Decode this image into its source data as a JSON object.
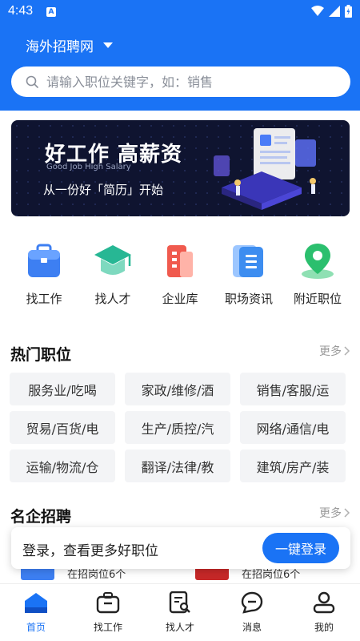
{
  "status_bar": {
    "time": "4:43",
    "notification_badge": "A"
  },
  "header": {
    "site_name": "海外招聘网",
    "search_placeholder": "请输入职位关键字，如：销售"
  },
  "banner": {
    "headline": "好工作 高薪资",
    "subline": "Good Job  High Salary",
    "tagline": "从一份好「简历」开始"
  },
  "quick_links": [
    {
      "label": "找工作",
      "icon": "briefcase-icon",
      "color": "#3d7ff2"
    },
    {
      "label": "找人才",
      "icon": "graduation-cap-icon",
      "color": "#27b794"
    },
    {
      "label": "企业库",
      "icon": "building-icon",
      "color": "#f05a4e"
    },
    {
      "label": "职场资讯",
      "icon": "news-icon",
      "color": "#3d8df0"
    },
    {
      "label": "附近职位",
      "icon": "location-pin-icon",
      "color": "#2bbf6e"
    }
  ],
  "hot_jobs": {
    "title": "热门职位",
    "more_label": "更多",
    "tags": [
      "服务业/吃喝",
      "家政/维修/酒",
      "销售/客服/运",
      "贸易/百货/电",
      "生产/质控/汽",
      "网络/通信/电",
      "运输/物流/仓",
      "翻译/法律/教",
      "建筑/房产/装"
    ]
  },
  "companies": {
    "title": "名企招聘",
    "more_label": "更多",
    "peek": [
      "在招岗位6个",
      "在招岗位6个"
    ]
  },
  "login_prompt": {
    "text": "登录，查看更多好职位",
    "button_label": "一键登录"
  },
  "tab_bar": [
    {
      "label": "首页",
      "icon": "home-icon",
      "active": true
    },
    {
      "label": "找工作",
      "icon": "briefcase-icon",
      "active": false
    },
    {
      "label": "找人才",
      "icon": "resume-search-icon",
      "active": false
    },
    {
      "label": "消息",
      "icon": "message-icon",
      "active": false
    },
    {
      "label": "我的",
      "icon": "person-icon",
      "active": false
    }
  ],
  "colors": {
    "primary": "#1a73f5",
    "tag_bg": "#f3f4f6",
    "banner_bg": "#0f1430"
  }
}
